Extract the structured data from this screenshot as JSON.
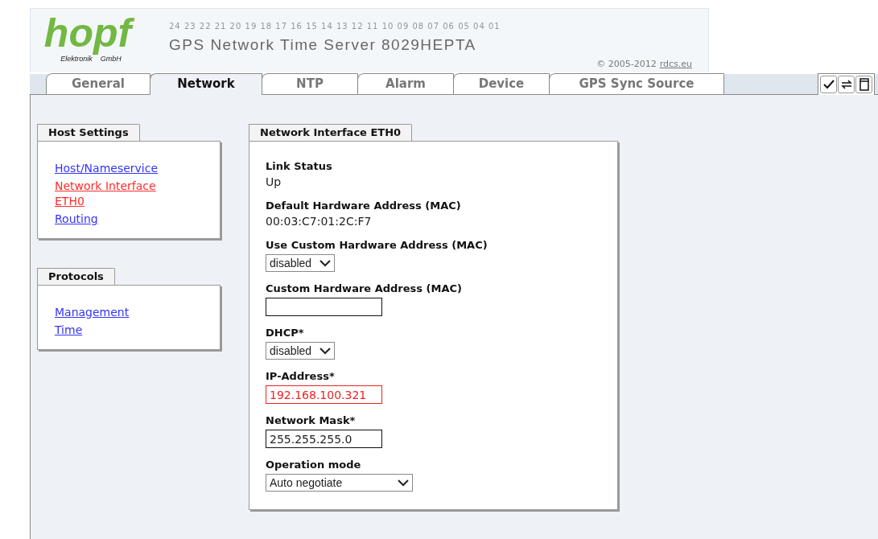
{
  "header": {
    "logo": {
      "wordmark": "hopf",
      "left": "Elektronik",
      "right": "GmbH"
    },
    "scale": "24 23 22 21 20 19 18 17 16 15 14 13 12 11 10 09 08 07 06 05 04 01",
    "title": "GPS Network Time Server 8029HEPTA",
    "copyright": "© 2005-2012",
    "copyright_link": "rdcs.eu"
  },
  "tabs": [
    {
      "label": "General",
      "selected": false
    },
    {
      "label": "Network",
      "selected": true
    },
    {
      "label": "NTP",
      "selected": false
    },
    {
      "label": "Alarm",
      "selected": false
    },
    {
      "label": "Device",
      "selected": false
    },
    {
      "label": "GPS Sync Source",
      "selected": false
    }
  ],
  "toolbar": [
    {
      "kind": "check"
    },
    {
      "kind": "swap"
    },
    {
      "kind": "page"
    }
  ],
  "sidebar": [
    {
      "title": "Host Settings",
      "links": [
        {
          "label": "Host/Nameservice",
          "selected": false
        },
        {
          "label": "Network Interface ETH0",
          "selected": true
        },
        {
          "label": "Routing",
          "selected": false
        }
      ]
    },
    {
      "title": "Protocols",
      "links": [
        {
          "label": "Management",
          "selected": false
        },
        {
          "label": "Time",
          "selected": false
        }
      ]
    }
  ],
  "panel": {
    "title": "Network Interface ETH0",
    "fields": [
      {
        "kind": "static",
        "label": "Link Status",
        "value": "Up"
      },
      {
        "kind": "static",
        "label": "Default Hardware Address (MAC)",
        "value": "00:03:C7:01:2C:F7"
      },
      {
        "kind": "select",
        "label": "Use Custom Hardware Address (MAC)",
        "value": "disabled",
        "wide": false
      },
      {
        "kind": "text",
        "label": "Custom Hardware Address (MAC)",
        "invalid": false
      },
      {
        "kind": "select",
        "label": "DHCP*",
        "value": "disabled",
        "wide": false
      },
      {
        "kind": "text",
        "label": "IP-Address*",
        "value": "192.168.100.321",
        "invalid": true
      },
      {
        "kind": "text",
        "label": "Network Mask*",
        "value": "255.255.255.0",
        "invalid": false
      },
      {
        "kind": "select",
        "label": "Operation mode",
        "value": "Auto negotiate",
        "wide": true
      }
    ]
  }
}
